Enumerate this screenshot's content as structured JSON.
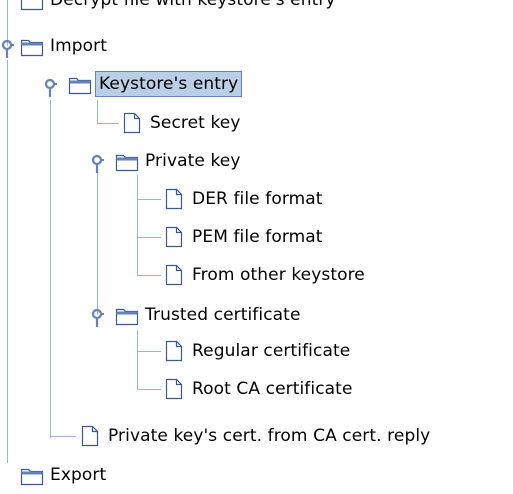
{
  "tree": {
    "items": [
      {
        "label": "Decrypt file with keystore's entry",
        "type": "folder",
        "state": "clipped"
      },
      {
        "label": "Import",
        "type": "folder",
        "state": "expanded"
      },
      {
        "label": "Keystore's entry",
        "type": "folder",
        "state": "expanded",
        "selected": true
      },
      {
        "label": "Secret key",
        "type": "file"
      },
      {
        "label": "Private key",
        "type": "folder",
        "state": "expanded"
      },
      {
        "label": "DER file format",
        "type": "file"
      },
      {
        "label": "PEM file format",
        "type": "file"
      },
      {
        "label": "From other keystore",
        "type": "file"
      },
      {
        "label": "Trusted certificate",
        "type": "folder",
        "state": "expanded"
      },
      {
        "label": "Regular certificate",
        "type": "file"
      },
      {
        "label": "Root CA certificate",
        "type": "file"
      },
      {
        "label": "Private key's cert. from CA cert. reply",
        "type": "file"
      },
      {
        "label": "Export",
        "type": "folder",
        "state": "clipped"
      }
    ]
  },
  "colors": {
    "selection_bg": "#b8cfe5",
    "selection_border": "#6382be",
    "tree_line": "#99b6d9",
    "handle": "#6382be"
  },
  "icons": {
    "folder": "folder-icon",
    "file": "document-icon",
    "handle": "tree-expand-handle-icon"
  }
}
